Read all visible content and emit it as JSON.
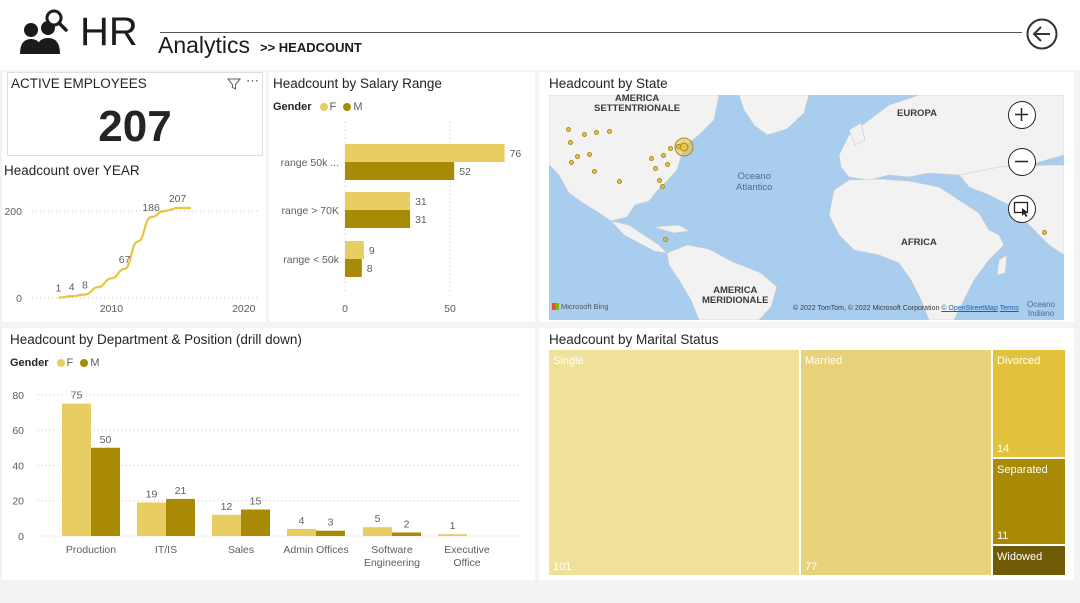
{
  "header": {
    "brand": "HR",
    "section": "Analytics",
    "crumb": ">> HEADCOUNT"
  },
  "icons": {
    "logo": "people-search-icon",
    "back": "back-arrow-icon",
    "filter": "filter-icon",
    "more": "more-options-icon",
    "zoom_in": "zoom-in-icon",
    "zoom_out": "zoom-out-icon",
    "select": "map-select-icon"
  },
  "colors": {
    "female": "#e8cd63",
    "male": "#a88a06",
    "single": "#efe197",
    "married": "#e7d27a",
    "divorced": "#e2c23d",
    "separated": "#a88a06",
    "widowed": "#6f5a05",
    "line": "#e8c53e"
  },
  "kpi": {
    "title": "ACTIVE EMPLOYEES",
    "value": "207"
  },
  "headcount_year": {
    "title": "Headcount over YEAR"
  },
  "salary": {
    "title": "Headcount by Salary Range",
    "legend_title": "Gender",
    "legend_f": "F",
    "legend_m": "M"
  },
  "state_map": {
    "title": "Headcount by State",
    "labels": {
      "north_america": "AMERICA\nSETTENTRIONALE",
      "europe": "EUROPA",
      "ocean": "Oceano\nAtlantico",
      "africa": "AFRICA",
      "south_america": "AMERICA\nMERIDIONALE",
      "indian_ocean": "Oceano\nIndiano"
    },
    "attribution": "© 2022 TomTom, © 2022 Microsoft Corporation",
    "osm": "© OpenStreetMap",
    "terms": "Terms",
    "bing": "Microsoft Bing"
  },
  "dept": {
    "title": "Headcount by Department & Position (drill down)",
    "legend_title": "Gender",
    "legend_f": "F",
    "legend_m": "M"
  },
  "marital": {
    "title": "Headcount by Marital Status"
  },
  "chart_data": [
    {
      "type": "line",
      "title": "Headcount over YEAR",
      "x": [
        2006,
        2007,
        2008,
        2009,
        2010,
        2011,
        2012,
        2013,
        2014
      ],
      "values": [
        1,
        4,
        8,
        67,
        186,
        207
      ],
      "points": [
        [
          2006,
          1
        ],
        [
          2007,
          4
        ],
        [
          2008,
          8
        ],
        [
          2011,
          67
        ],
        [
          2013,
          186
        ],
        [
          2015,
          207
        ]
      ],
      "curve": [
        [
          2006,
          1
        ],
        [
          2007,
          4
        ],
        [
          2008,
          8
        ],
        [
          2009,
          25
        ],
        [
          2010,
          45
        ],
        [
          2011,
          67
        ],
        [
          2012,
          130
        ],
        [
          2013,
          186
        ],
        [
          2014,
          200
        ],
        [
          2015,
          207
        ],
        [
          2016,
          207
        ]
      ],
      "xticks": [
        "2010",
        "2020"
      ],
      "yticks": [
        "0",
        "200"
      ],
      "xlim": [
        2004,
        2021
      ],
      "ylim": [
        0,
        230
      ]
    },
    {
      "type": "bar",
      "orientation": "horizontal",
      "title": "Headcount by Salary Range",
      "categories": [
        "range 50k ...",
        "range > 70K",
        "range < 50k"
      ],
      "series": [
        {
          "name": "F",
          "values": [
            76,
            31,
            9
          ]
        },
        {
          "name": "M",
          "values": [
            52,
            31,
            8
          ]
        }
      ],
      "xticks": [
        "0",
        "50"
      ],
      "xlim": [
        0,
        80
      ]
    },
    {
      "type": "bar",
      "title": "Headcount by Department & Position (drill down)",
      "categories": [
        "Production",
        "IT/IS",
        "Sales",
        "Admin Offices",
        "Software Engineering",
        "Executive Office"
      ],
      "category_lines": [
        [
          "Production"
        ],
        [
          "IT/IS"
        ],
        [
          "Sales"
        ],
        [
          "Admin Offices"
        ],
        [
          "Software",
          "Engineering"
        ],
        [
          "Executive",
          "Office"
        ]
      ],
      "series": [
        {
          "name": "F",
          "values": [
            75,
            19,
            12,
            4,
            5,
            1
          ]
        },
        {
          "name": "M",
          "values": [
            50,
            21,
            15,
            3,
            2,
            null
          ]
        }
      ],
      "yticks": [
        "0",
        "20",
        "40",
        "60",
        "80"
      ],
      "ylim": [
        0,
        85
      ]
    },
    {
      "type": "treemap",
      "title": "Headcount by Marital Status",
      "categories": [
        "Single",
        "Married",
        "Divorced",
        "Separated",
        "Widowed"
      ],
      "values": [
        101,
        77,
        14,
        11,
        null
      ],
      "value_labels": [
        "101",
        "77",
        "14",
        "11",
        ""
      ]
    }
  ]
}
